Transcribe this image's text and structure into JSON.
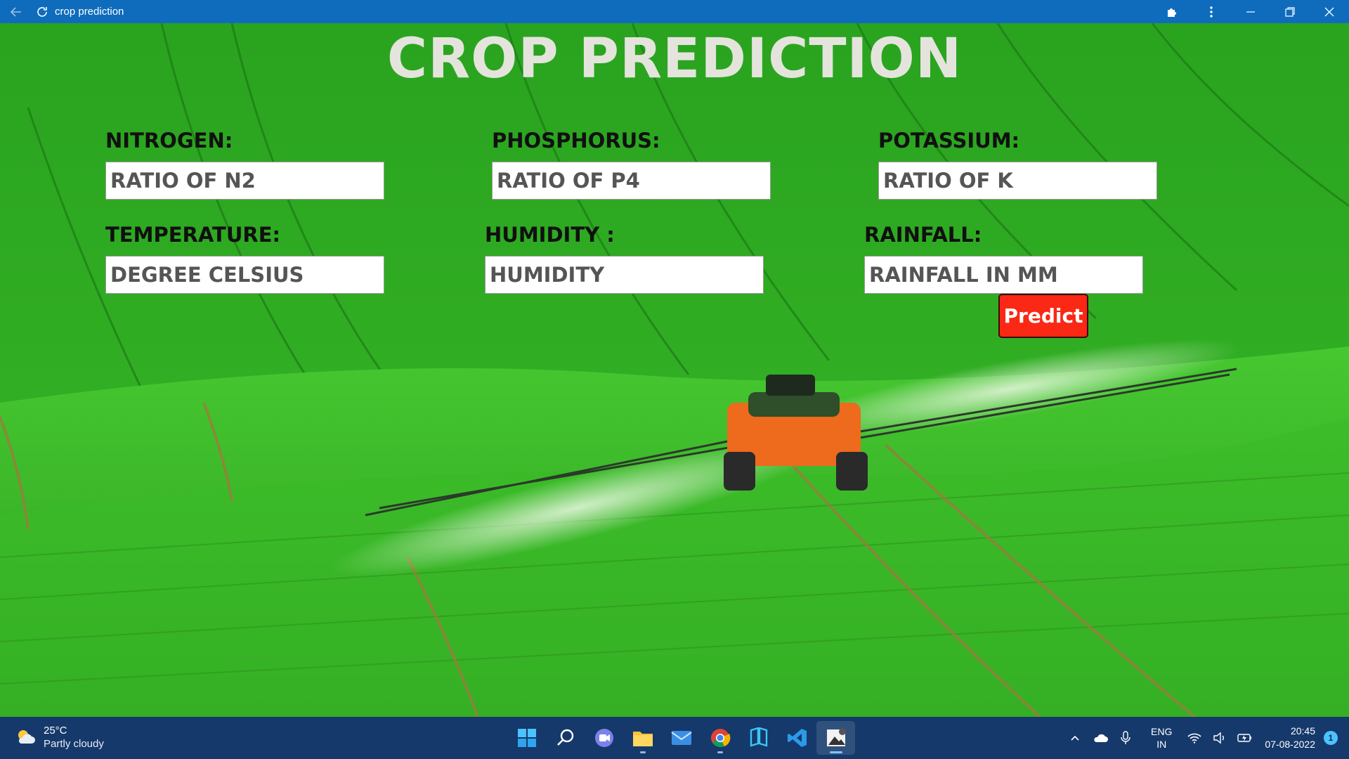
{
  "window": {
    "title": "crop prediction",
    "icons": [
      "back-arrow-icon",
      "refresh-icon",
      "extensions-icon",
      "more-options-icon",
      "minimize-icon",
      "restore-icon",
      "close-icon"
    ]
  },
  "form": {
    "title": "CROP PREDICTION",
    "fields": [
      {
        "label": "NITROGEN:",
        "placeholder": "RATIO OF N2"
      },
      {
        "label": "PHOSPHORUS:",
        "placeholder": "RATIO OF P4"
      },
      {
        "label": "POTASSIUM:",
        "placeholder": "RATIO OF K"
      },
      {
        "label": "TEMPERATURE:",
        "placeholder": "DEGREE CELSIUS"
      },
      {
        "label": "HUMIDITY :",
        "placeholder": "HUMIDITY"
      },
      {
        "label": "RAINFALL:",
        "placeholder": "RAINFALL IN MM"
      }
    ],
    "predict_label": "Predict"
  },
  "taskbar": {
    "weather": {
      "temp": "25°C",
      "desc": "Partly cloudy",
      "icon": "partly-cloudy-icon"
    },
    "apps": [
      "start-icon",
      "search-icon",
      "teams-chat-icon",
      "file-explorer-icon",
      "mail-icon",
      "chrome-icon",
      "udacity-icon",
      "vscode-icon",
      "app-preview-icon"
    ],
    "lang_line1": "ENG",
    "lang_line2": "IN",
    "time": "20:45",
    "date": "07-08-2022",
    "notification_count": "1"
  },
  "colors": {
    "titlebar": "#0f6cbd",
    "title_text": "#e4e4dd",
    "predict_button": "#fa2814",
    "taskbar": "#15396b",
    "field_green": "#35b526"
  }
}
